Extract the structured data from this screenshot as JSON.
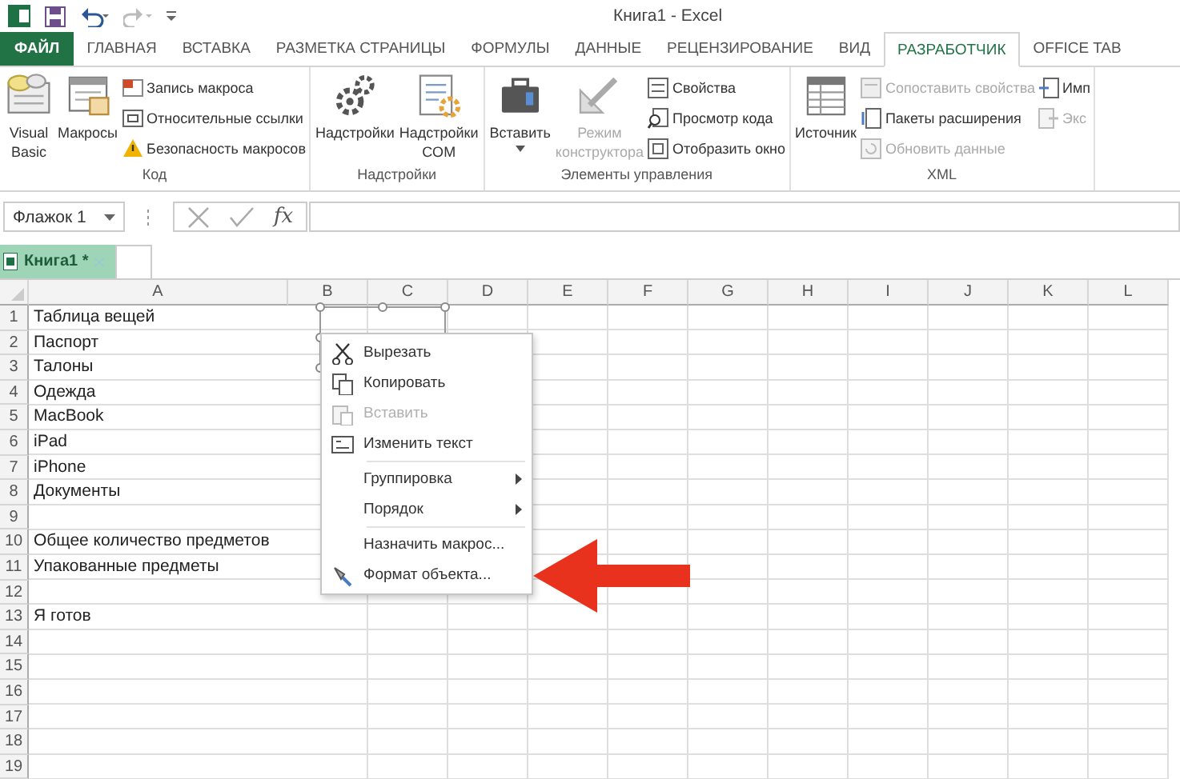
{
  "window": {
    "title": "Книга1 - Excel"
  },
  "ribbon_tabs": [
    {
      "label": "ФАЙЛ",
      "kind": "file",
      "selected": false
    },
    {
      "label": "ГЛАВНАЯ",
      "kind": "tab",
      "selected": false
    },
    {
      "label": "ВСТАВКА",
      "kind": "tab",
      "selected": false
    },
    {
      "label": "РАЗМЕТКА СТРАНИЦЫ",
      "kind": "tab",
      "selected": false
    },
    {
      "label": "ФОРМУЛЫ",
      "kind": "tab",
      "selected": false
    },
    {
      "label": "ДАННЫЕ",
      "kind": "tab",
      "selected": false
    },
    {
      "label": "РЕЦЕНЗИРОВАНИЕ",
      "kind": "tab",
      "selected": false
    },
    {
      "label": "ВИД",
      "kind": "tab",
      "selected": false
    },
    {
      "label": "РАЗРАБОТЧИК",
      "kind": "tab",
      "selected": true
    },
    {
      "label": "OFFICE TAB",
      "kind": "tab",
      "selected": false
    }
  ],
  "ribbon_groups": [
    {
      "label": "Код",
      "buttons": [
        {
          "label": "Visual Basic",
          "kind": "large",
          "disabled": false
        },
        {
          "label": "Макросы",
          "kind": "large",
          "disabled": false
        },
        {
          "label": "Запись макроса",
          "kind": "small",
          "disabled": false
        },
        {
          "label": "Относительные ссылки",
          "kind": "small",
          "disabled": false
        },
        {
          "label": "Безопасность макросов",
          "kind": "small",
          "disabled": false
        }
      ]
    },
    {
      "label": "Надстройки",
      "buttons": [
        {
          "label": "Надстройки",
          "kind": "large",
          "disabled": false
        },
        {
          "label": "Надстройки COM",
          "kind": "large",
          "disabled": false
        }
      ]
    },
    {
      "label": "Элементы управления",
      "buttons": [
        {
          "label": "Вставить",
          "kind": "large",
          "disabled": false,
          "dropdown": true
        },
        {
          "label": "Режим конструктора",
          "kind": "large",
          "disabled": true
        },
        {
          "label": "Свойства",
          "kind": "small",
          "disabled": false
        },
        {
          "label": "Просмотр кода",
          "kind": "small",
          "disabled": false
        },
        {
          "label": "Отобразить окно",
          "kind": "small",
          "disabled": false
        }
      ]
    },
    {
      "label": "XML",
      "buttons": [
        {
          "label": "Источник",
          "kind": "large",
          "disabled": false
        },
        {
          "label": "Сопоставить свойства",
          "kind": "small",
          "disabled": true
        },
        {
          "label": "Пакеты расширения",
          "kind": "small",
          "disabled": false
        },
        {
          "label": "Обновить данные",
          "kind": "small",
          "disabled": true
        },
        {
          "label": "Имп",
          "kind": "small",
          "disabled": false
        },
        {
          "label": "Экс",
          "kind": "small",
          "disabled": true
        }
      ]
    }
  ],
  "formula_bar": {
    "name_box": "Флажок 1",
    "function_label": "fx"
  },
  "workbook_tabs": [
    {
      "label": "Книга1 *",
      "selected": true
    }
  ],
  "sheet": {
    "columns": [
      "A",
      "B",
      "C",
      "D",
      "E",
      "F",
      "G",
      "H",
      "I",
      "J",
      "K",
      "L"
    ],
    "rows": [
      {
        "header": "1",
        "column_a": "Таблица вещей"
      },
      {
        "header": "2",
        "column_a": "Паспорт"
      },
      {
        "header": "3",
        "column_a": "Талоны"
      },
      {
        "header": "4",
        "column_a": "Одежда"
      },
      {
        "header": "5",
        "column_a": "MacBook"
      },
      {
        "header": "6",
        "column_a": "iPad"
      },
      {
        "header": "7",
        "column_a": "iPhone"
      },
      {
        "header": "8",
        "column_a": "Документы"
      },
      {
        "header": "9"
      },
      {
        "header": "10",
        "column_a": "Общее количество предметов"
      },
      {
        "header": "11",
        "column_a": "Упакованные предметы"
      },
      {
        "header": "12"
      },
      {
        "header": "13",
        "column_a": "Я готов"
      },
      {
        "header": "14"
      },
      {
        "header": "15"
      },
      {
        "header": "16"
      },
      {
        "header": "17"
      },
      {
        "header": "18"
      },
      {
        "header": "19"
      }
    ]
  },
  "context_menu": [
    {
      "label": "Вырезать",
      "disabled": false,
      "submenu": false,
      "separator_before": false
    },
    {
      "label": "Копировать",
      "disabled": false,
      "submenu": false,
      "separator_before": false
    },
    {
      "label": "Вставить",
      "disabled": true,
      "submenu": false,
      "separator_before": false
    },
    {
      "label": "Изменить текст",
      "disabled": false,
      "submenu": false,
      "separator_before": false
    },
    {
      "label": "Группировка",
      "disabled": false,
      "submenu": true,
      "separator_before": true
    },
    {
      "label": "Порядок",
      "disabled": false,
      "submenu": true,
      "separator_before": false
    },
    {
      "label": "Назначить макрос...",
      "disabled": false,
      "submenu": false,
      "separator_before": true
    },
    {
      "label": "Формат объекта...",
      "disabled": false,
      "submenu": false,
      "separator_before": false
    }
  ]
}
